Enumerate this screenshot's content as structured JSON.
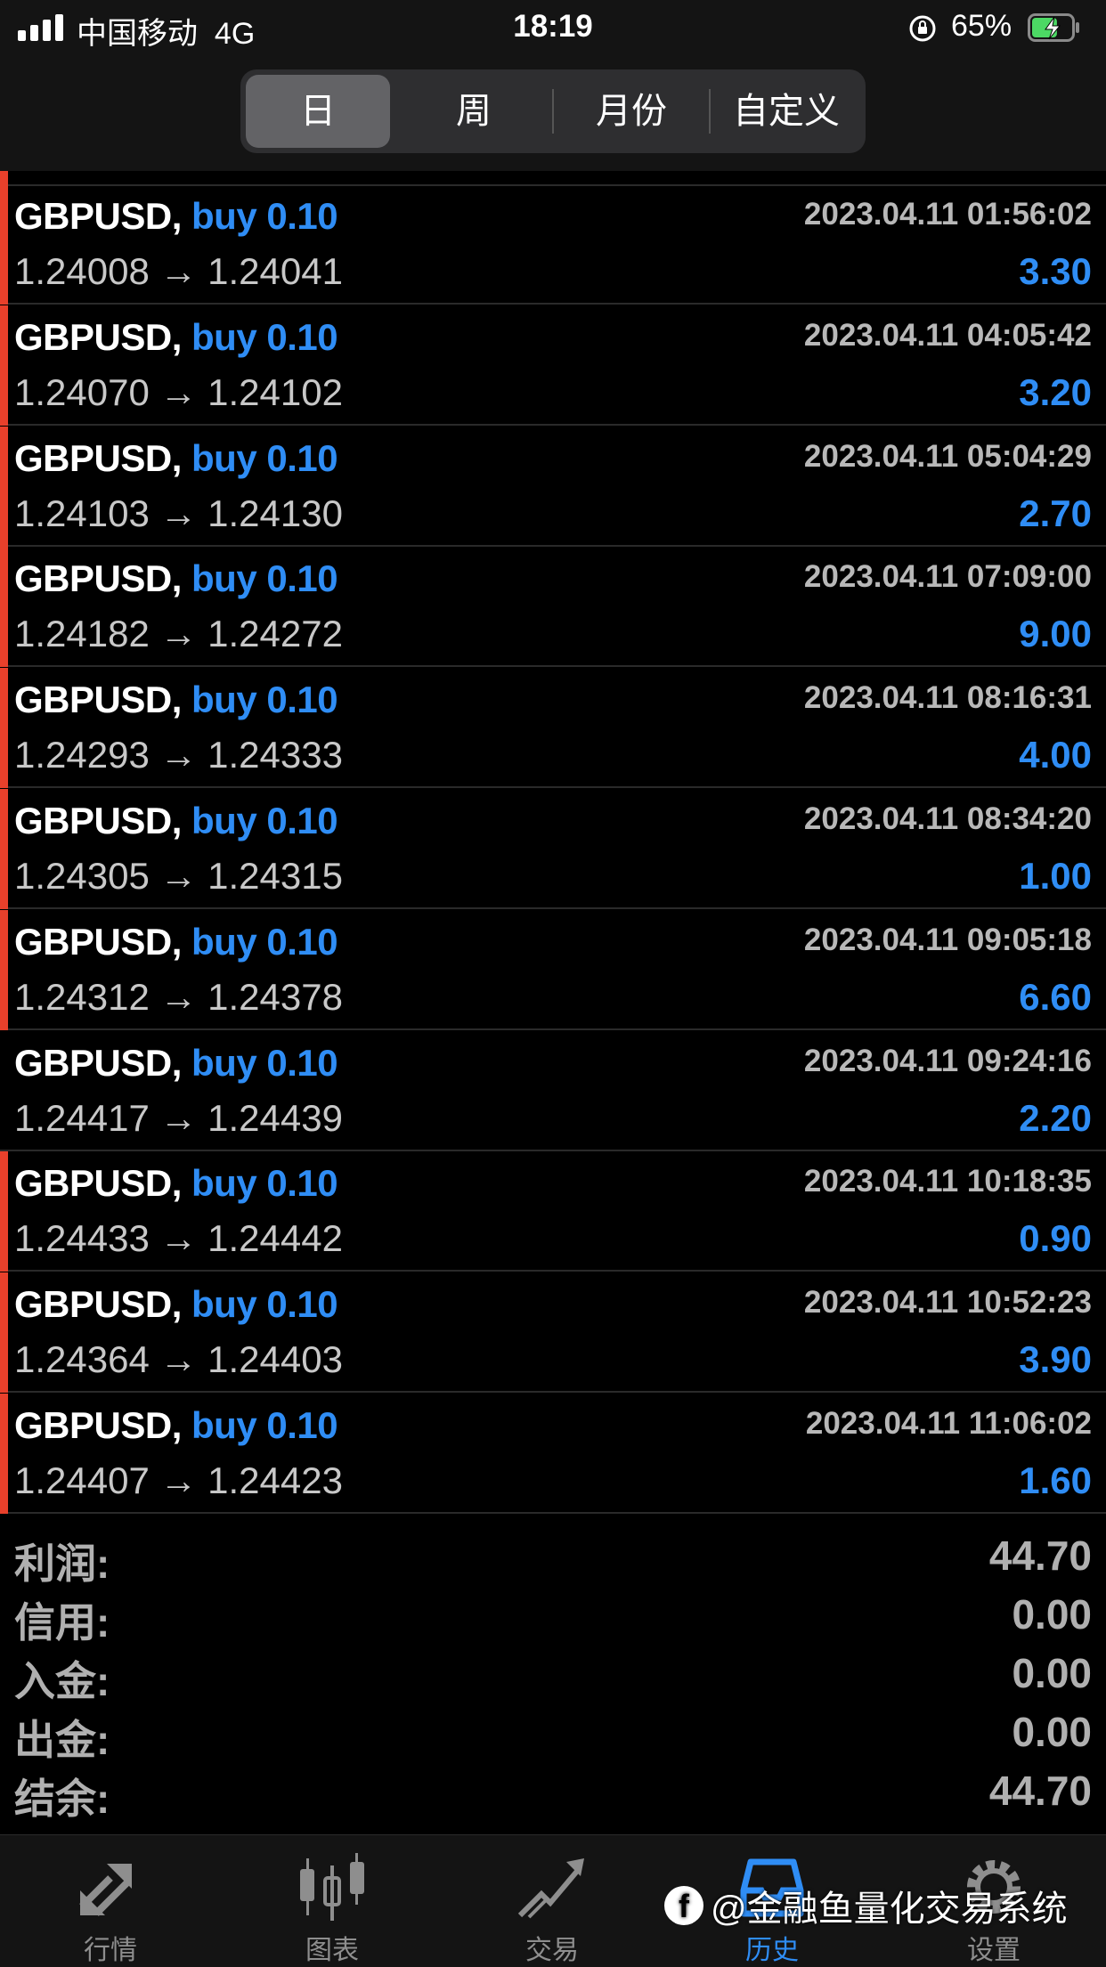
{
  "status_bar": {
    "carrier": "中国移动",
    "network": "4G",
    "time": "18:19",
    "battery_percent": "65%",
    "battery_level": 0.65,
    "battery_color": "#4cd964"
  },
  "period_tabs": [
    {
      "label": "日",
      "active": true
    },
    {
      "label": "周",
      "active": false
    },
    {
      "label": "月份",
      "active": false
    },
    {
      "label": "自定义",
      "active": false
    }
  ],
  "trades": [
    {
      "symbol": "GBPUSD,",
      "action": "buy 0.10",
      "time": "2023.04.11 01:56:02",
      "prices": "1.24008 → 1.24041",
      "profit": "3.30",
      "marker": true
    },
    {
      "symbol": "GBPUSD,",
      "action": "buy 0.10",
      "time": "2023.04.11 04:05:42",
      "prices": "1.24070 → 1.24102",
      "profit": "3.20",
      "marker": true
    },
    {
      "symbol": "GBPUSD,",
      "action": "buy 0.10",
      "time": "2023.04.11 05:04:29",
      "prices": "1.24103 → 1.24130",
      "profit": "2.70",
      "marker": true
    },
    {
      "symbol": "GBPUSD,",
      "action": "buy 0.10",
      "time": "2023.04.11 07:09:00",
      "prices": "1.24182 → 1.24272",
      "profit": "9.00",
      "marker": true
    },
    {
      "symbol": "GBPUSD,",
      "action": "buy 0.10",
      "time": "2023.04.11 08:16:31",
      "prices": "1.24293 → 1.24333",
      "profit": "4.00",
      "marker": true
    },
    {
      "symbol": "GBPUSD,",
      "action": "buy 0.10",
      "time": "2023.04.11 08:34:20",
      "prices": "1.24305 → 1.24315",
      "profit": "1.00",
      "marker": true
    },
    {
      "symbol": "GBPUSD,",
      "action": "buy 0.10",
      "time": "2023.04.11 09:05:18",
      "prices": "1.24312 → 1.24378",
      "profit": "6.60",
      "marker": true
    },
    {
      "symbol": "GBPUSD,",
      "action": "buy 0.10",
      "time": "2023.04.11 09:24:16",
      "prices": "1.24417 → 1.24439",
      "profit": "2.20",
      "marker": false
    },
    {
      "symbol": "GBPUSD,",
      "action": "buy 0.10",
      "time": "2023.04.11 10:18:35",
      "prices": "1.24433 → 1.24442",
      "profit": "0.90",
      "marker": true
    },
    {
      "symbol": "GBPUSD,",
      "action": "buy 0.10",
      "time": "2023.04.11 10:52:23",
      "prices": "1.24364 → 1.24403",
      "profit": "3.90",
      "marker": true
    },
    {
      "symbol": "GBPUSD,",
      "action": "buy 0.10",
      "time": "2023.04.11 11:06:02",
      "prices": "1.24407 → 1.24423",
      "profit": "1.60",
      "marker": true
    }
  ],
  "summary": [
    {
      "label": "利润:",
      "value": "44.70"
    },
    {
      "label": "信用:",
      "value": "0.00"
    },
    {
      "label": "入金:",
      "value": "0.00"
    },
    {
      "label": "出金:",
      "value": "0.00"
    },
    {
      "label": "结余:",
      "value": "44.70"
    }
  ],
  "tabbar": [
    {
      "label": "行情",
      "icon": "quotes-arrows-icon",
      "active": false
    },
    {
      "label": "图表",
      "icon": "candlestick-chart-icon",
      "active": false
    },
    {
      "label": "交易",
      "icon": "trade-trend-icon",
      "active": false
    },
    {
      "label": "历史",
      "icon": "history-icon",
      "active": true
    },
    {
      "label": "设置",
      "icon": "gear-icon",
      "active": false
    }
  ],
  "watermark": {
    "text": "@金融鱼量化交易系统",
    "icon": "facebook-logo-icon"
  },
  "colors": {
    "accent": "#2f8df5",
    "marker": "#e8402b",
    "background": "#000000"
  }
}
